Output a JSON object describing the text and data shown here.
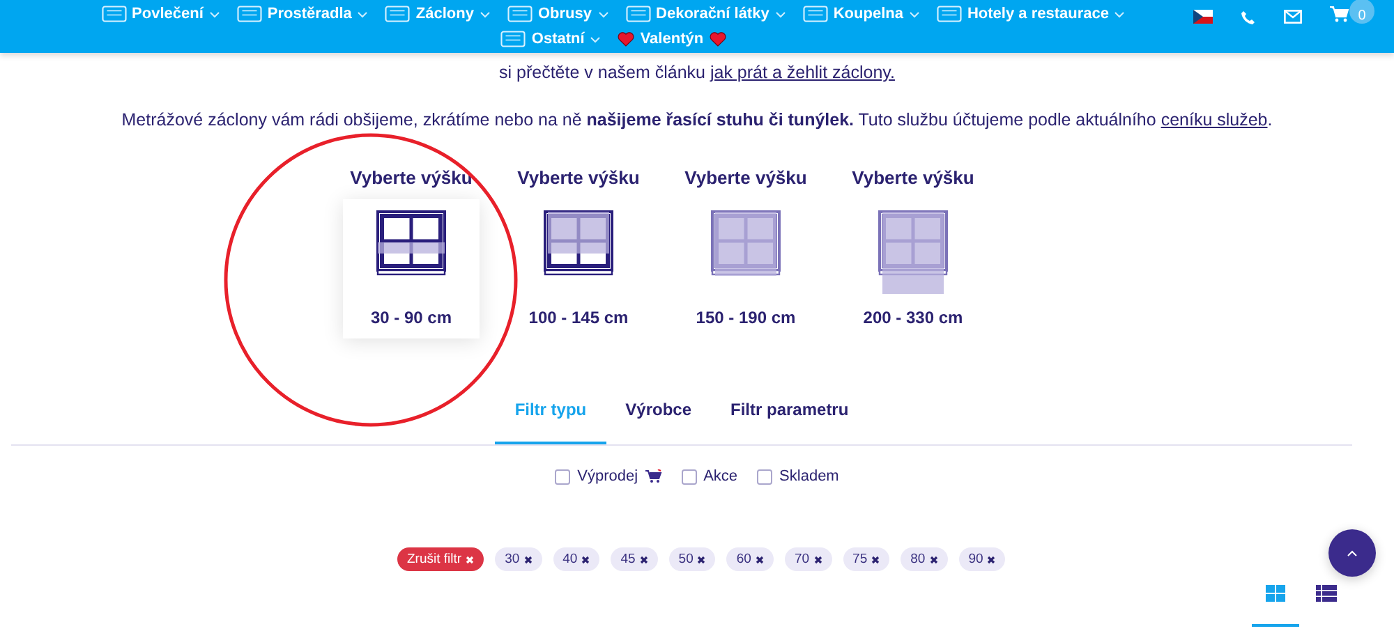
{
  "header": {
    "nav_rows": [
      [
        "Povlečení",
        "Prostěradla",
        "Záclony",
        "Obrusy",
        "Dekorační látky",
        "Koupelna",
        "Hotely a restaurace"
      ],
      [
        "Ostatní",
        "Valentýn"
      ]
    ],
    "cart_count": "0"
  },
  "intro": {
    "line": "si přečtěte v našem článku ",
    "link": "jak prát a žehlit záclony.",
    "paragraph": "Metrážové záclony vám rádi obšijeme, zkrátíme nebo na ně **našijeme řasící stuhu či tunýlek.** Tuto službu účtujeme podle aktuálního ",
    "paragraph_link": "ceníku služeb",
    "paragraph_end": "."
  },
  "heights": [
    {
      "title": "Vyberte výšku",
      "range": "30 - 90 cm",
      "kind": "short",
      "selected": true
    },
    {
      "title": "Vyberte výšku",
      "range": "100 - 145 cm",
      "kind": "medium",
      "selected": false
    },
    {
      "title": "Vyberte výšku",
      "range": "150 - 190 cm",
      "kind": "long",
      "selected": false
    },
    {
      "title": "Vyberte výšku",
      "range": "200 - 330 cm",
      "kind": "extra",
      "selected": false
    }
  ],
  "tabs": [
    {
      "label": "Filtr typu",
      "selected": true
    },
    {
      "label": "Výrobce",
      "selected": false
    },
    {
      "label": "Filtr parametru",
      "selected": false
    }
  ],
  "checkboxes": [
    {
      "label": "Výprodej",
      "checked": false,
      "kind": "cart"
    },
    {
      "label": "Akce",
      "checked": false,
      "kind": "plain"
    },
    {
      "label": "Skladem",
      "checked": false,
      "kind": "plain"
    }
  ],
  "chips": [
    {
      "label": "Zrušit filtr",
      "kind": "clear"
    },
    {
      "label": "30",
      "kind": "value"
    },
    {
      "label": "40",
      "kind": "value"
    },
    {
      "label": "45",
      "kind": "value"
    },
    {
      "label": "50",
      "kind": "value"
    },
    {
      "label": "60",
      "kind": "value"
    },
    {
      "label": "70",
      "kind": "value"
    },
    {
      "label": "75",
      "kind": "value"
    },
    {
      "label": "80",
      "kind": "value"
    },
    {
      "label": "90",
      "kind": "value"
    }
  ],
  "views": [
    {
      "kind": "grid",
      "selected": true
    },
    {
      "kind": "list",
      "selected": false
    }
  ]
}
